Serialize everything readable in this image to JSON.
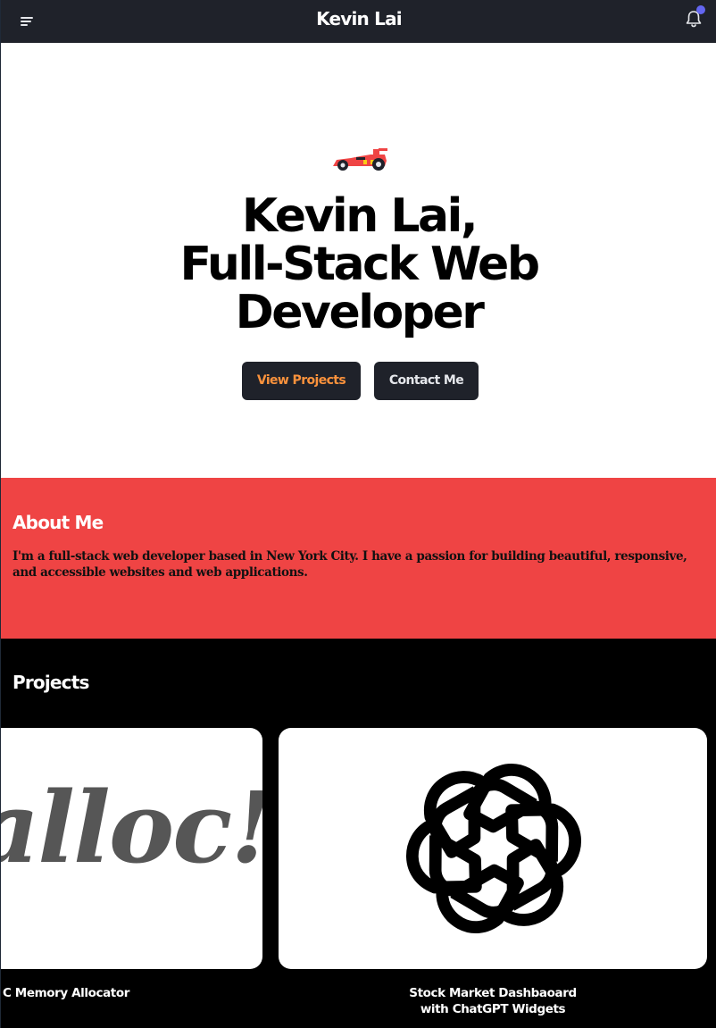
{
  "navbar": {
    "brand": "Kevin Lai",
    "menu_icon": "hamburger-menu-icon",
    "notification_icon": "bell-icon",
    "notification_dot_color": "#6366f1"
  },
  "hero": {
    "icon": "race-car-icon",
    "title_line1": "Kevin Lai,",
    "title_line2": "Full-Stack Web",
    "title_line3": "Developer",
    "view_projects_label": "View Projects",
    "contact_label": "Contact Me"
  },
  "about": {
    "heading": "About Me",
    "text": "I'm a full-stack web developer based in New York City. I have a passion for building beautiful, responsive, and accessible websites and web applications.",
    "background": "#ef4444"
  },
  "projects": {
    "heading": "Projects",
    "items": [
      {
        "image_text": "alloc!",
        "title": "C Memory Allocator"
      },
      {
        "image_icon": "openai-logo-icon",
        "title_line1": "Stock Market Dashbaoard",
        "title_line2": "with ChatGPT Widgets"
      }
    ]
  },
  "colors": {
    "navbar": "#1f222a",
    "accent_orange": "#fb923c",
    "projects_bg": "#000000"
  }
}
